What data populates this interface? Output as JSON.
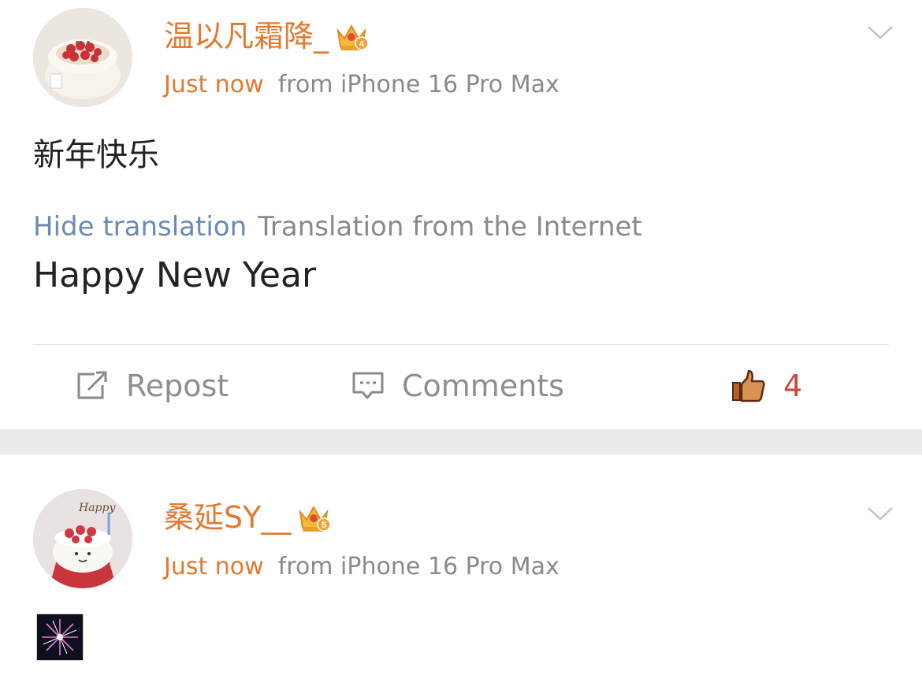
{
  "posts": [
    {
      "username": "温以凡霜降_",
      "badge_level": "4",
      "time": "Just now",
      "source": "from iPhone 16 Pro Max",
      "content": "新年快乐",
      "translation": {
        "hide_label": "Hide translation",
        "source_note": "Translation from the Internet",
        "text": "Happy New Year"
      },
      "actions": {
        "repost_label": "Repost",
        "comments_label": "Comments",
        "like_count": "4"
      }
    },
    {
      "username": "桑延SY__",
      "badge_level": "5",
      "time": "Just now",
      "source": "from iPhone 16 Pro Max",
      "avatar_text": "Happy"
    }
  ],
  "colors": {
    "username": "#e5782f",
    "link": "#6b8bb5",
    "like": "#d0493a",
    "muted": "#8a8a8a",
    "separator": "#ececec"
  },
  "icons": [
    "crown-badge-icon",
    "chevron-down-icon",
    "repost-icon",
    "comment-icon",
    "thumbs-up-icon",
    "fireworks-sticker"
  ]
}
